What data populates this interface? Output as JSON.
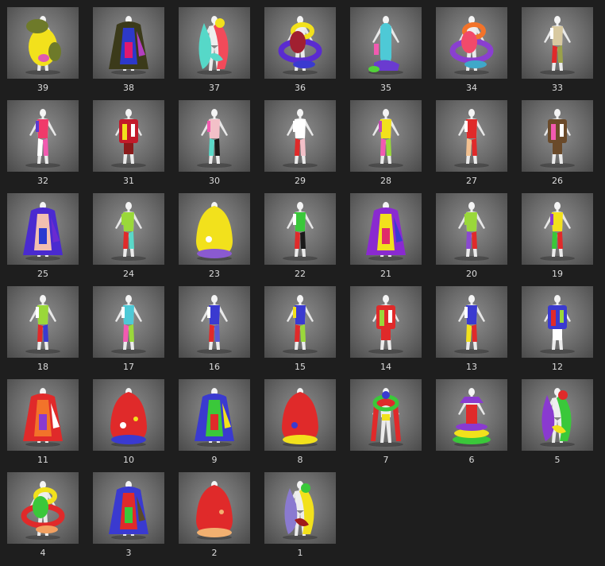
{
  "items": [
    {
      "label": "39",
      "palette": [
        "#6e7a2a",
        "#f2e11c",
        "#e05ab0",
        "#8a4d1e"
      ],
      "style": "blob"
    },
    {
      "label": "38",
      "palette": [
        "#3b3a1a",
        "#2d39c9",
        "#e0196e",
        "#b23ec0"
      ],
      "style": "cape"
    },
    {
      "label": "37",
      "palette": [
        "#56d8c8",
        "#f24a5a",
        "#f2e11c",
        "#5ad8c8"
      ],
      "style": "flow"
    },
    {
      "label": "36",
      "palette": [
        "#5a2bd0",
        "#f2e11c",
        "#a12030",
        "#3a3ad0"
      ],
      "style": "coil"
    },
    {
      "label": "35",
      "palette": [
        "#4ec9d6",
        "#f25ab0",
        "#52d13a",
        "#6a3bd0"
      ],
      "style": "tube"
    },
    {
      "label": "34",
      "palette": [
        "#8a3fd0",
        "#f2732a",
        "#f24a6a",
        "#3fa8c9"
      ],
      "style": "coil"
    },
    {
      "label": "33",
      "palette": [
        "#d8c9a0",
        "#e02a2a",
        "#9aa04a",
        "#ffffff"
      ],
      "style": "slim"
    },
    {
      "label": "32",
      "palette": [
        "#f03a6a",
        "#ffffff",
        "#f25ab0",
        "#5a3ad0"
      ],
      "style": "slim"
    },
    {
      "label": "31",
      "palette": [
        "#c21a2a",
        "#f2e11c",
        "#ffffff",
        "#8a1a1a"
      ],
      "style": "box"
    },
    {
      "label": "30",
      "palette": [
        "#f2c0c8",
        "#5ad8c8",
        "#1a1a1a",
        "#f25ab0"
      ],
      "style": "slim"
    },
    {
      "label": "29",
      "palette": [
        "#ffffff",
        "#e02a2a",
        "#f2c0c8",
        "#ffffff"
      ],
      "style": "slim"
    },
    {
      "label": "28",
      "palette": [
        "#f2e11c",
        "#f25ab0",
        "#9ad83a",
        "#c04ab0"
      ],
      "style": "slim"
    },
    {
      "label": "27",
      "palette": [
        "#e02a2a",
        "#f2c090",
        "#e02a2a",
        "#ffffff"
      ],
      "style": "slim"
    },
    {
      "label": "26",
      "palette": [
        "#6a4a2a",
        "#f25ab0",
        "#ffffff",
        "#6a4a2a"
      ],
      "style": "box"
    },
    {
      "label": "25",
      "palette": [
        "#4a2ad0",
        "#f2c0b0",
        "#2a3ad0",
        "#6a2ad0"
      ],
      "style": "cape"
    },
    {
      "label": "24",
      "palette": [
        "#9ad83a",
        "#e02a2a",
        "#5ad8c8",
        "#9ad83a"
      ],
      "style": "slim"
    },
    {
      "label": "23",
      "palette": [
        "#f2e11c",
        "#8a5ad0",
        "#ffffff",
        "#f2e11c"
      ],
      "style": "bell"
    },
    {
      "label": "22",
      "palette": [
        "#3ac83a",
        "#e02a2a",
        "#1a1a1a",
        "#ffffff"
      ],
      "style": "slim"
    },
    {
      "label": "21",
      "palette": [
        "#8a2ad0",
        "#f2e11c",
        "#e02a6a",
        "#3a3ad0"
      ],
      "style": "cape"
    },
    {
      "label": "20",
      "palette": [
        "#9ad83a",
        "#8a4ad0",
        "#e02a2a",
        "#9ad83a"
      ],
      "style": "slim"
    },
    {
      "label": "19",
      "palette": [
        "#f2e11c",
        "#3ac83a",
        "#e02a2a",
        "#8a3ad0"
      ],
      "style": "slim"
    },
    {
      "label": "18",
      "palette": [
        "#9ad83a",
        "#e02a2a",
        "#3a3ad0",
        "#ffffff"
      ],
      "style": "slim"
    },
    {
      "label": "17",
      "palette": [
        "#4ec9d6",
        "#f25ab0",
        "#9ad83a",
        "#ffffff"
      ],
      "style": "slim"
    },
    {
      "label": "16",
      "palette": [
        "#3a3ad0",
        "#e02a2a",
        "#5a5ad0",
        "#ffffff"
      ],
      "style": "slim"
    },
    {
      "label": "15",
      "palette": [
        "#3a3ad0",
        "#e02a2a",
        "#9ad83a",
        "#f2e11c"
      ],
      "style": "slim"
    },
    {
      "label": "14",
      "palette": [
        "#e02a2a",
        "#9ad83a",
        "#ffffff",
        "#e02a2a"
      ],
      "style": "box"
    },
    {
      "label": "13",
      "palette": [
        "#3a3ad0",
        "#f2e11c",
        "#e02a2a",
        "#ffffff"
      ],
      "style": "slim"
    },
    {
      "label": "12",
      "palette": [
        "#3a3ad0",
        "#e02a2a",
        "#9ad83a",
        "#ffffff"
      ],
      "style": "box"
    },
    {
      "label": "11",
      "palette": [
        "#e02a2a",
        "#f2732a",
        "#8a3ad0",
        "#ffffff"
      ],
      "style": "cape"
    },
    {
      "label": "10",
      "palette": [
        "#e02a2a",
        "#3a3ad0",
        "#ffffff",
        "#f2e11c"
      ],
      "style": "bell"
    },
    {
      "label": "9",
      "palette": [
        "#3a3ad0",
        "#3ac83a",
        "#e02a2a",
        "#f2e11c"
      ],
      "style": "cape"
    },
    {
      "label": "8",
      "palette": [
        "#e02a2a",
        "#f2e11c",
        "#3a3ad0",
        "#e02a2a"
      ],
      "style": "bell"
    },
    {
      "label": "7",
      "palette": [
        "#e02a2a",
        "#3ac83a",
        "#f2e11c",
        "#3a3ad0"
      ],
      "style": "arch"
    },
    {
      "label": "6",
      "palette": [
        "#3ac83a",
        "#f2e11c",
        "#8a3ad0",
        "#e02a2a"
      ],
      "style": "stack"
    },
    {
      "label": "5",
      "palette": [
        "#8a3ad0",
        "#3ac83a",
        "#e02a2a",
        "#f2e11c"
      ],
      "style": "flow"
    },
    {
      "label": "4",
      "palette": [
        "#e02a2a",
        "#f2e11c",
        "#3ac83a",
        "#f2a060"
      ],
      "style": "coil"
    },
    {
      "label": "3",
      "palette": [
        "#3a3ad0",
        "#e02a2a",
        "#3ac83a",
        "#5a4a2a"
      ],
      "style": "cape"
    },
    {
      "label": "2",
      "palette": [
        "#e02a2a",
        "#f2b070",
        "#e02a2a",
        "#f2b070"
      ],
      "style": "bell"
    },
    {
      "label": "1",
      "palette": [
        "#8a7ad0",
        "#f2e11c",
        "#3ac83a",
        "#a01a1a"
      ],
      "style": "flow"
    }
  ]
}
